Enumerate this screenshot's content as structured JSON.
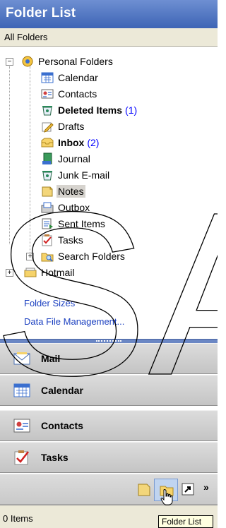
{
  "header": {
    "title": "Folder List"
  },
  "subheader": {
    "label": "All Folders"
  },
  "tree": {
    "root": {
      "label": "Personal Folders",
      "expander": "−"
    },
    "items": [
      {
        "label": "Calendar",
        "count": "",
        "icon": "calendar-icon"
      },
      {
        "label": "Contacts",
        "count": "",
        "icon": "contacts-icon"
      },
      {
        "label": "Deleted Items",
        "count": "(1)",
        "icon": "deleted-items-icon",
        "bold": true
      },
      {
        "label": "Drafts",
        "count": "",
        "icon": "drafts-icon"
      },
      {
        "label": "Inbox",
        "count": "(2)",
        "icon": "inbox-icon",
        "bold": true
      },
      {
        "label": "Journal",
        "count": "",
        "icon": "journal-icon"
      },
      {
        "label": "Junk E-mail",
        "count": "",
        "icon": "junk-icon"
      },
      {
        "label": "Notes",
        "count": "",
        "icon": "notes-icon",
        "selected": true
      },
      {
        "label": "Outbox",
        "count": "",
        "icon": "outbox-icon"
      },
      {
        "label": "Sent Items",
        "count": "",
        "icon": "sent-items-icon"
      },
      {
        "label": "Tasks",
        "count": "",
        "icon": "tasks-icon"
      },
      {
        "label": "Search Folders",
        "count": "",
        "icon": "search-folders-icon",
        "expander": "+"
      }
    ],
    "hotmail": {
      "label": "Hotmail",
      "expander": "+"
    }
  },
  "links": {
    "folder_sizes": "Folder Sizes",
    "data_file_management": "Data File Management..."
  },
  "nav": {
    "mail": "Mail",
    "calendar": "Calendar",
    "contacts": "Contacts",
    "tasks": "Tasks"
  },
  "bottombar": {
    "more": "»"
  },
  "status": {
    "items": "0 Items"
  },
  "tooltip": {
    "text": "Folder List"
  },
  "watermark": {
    "text": "SA"
  },
  "colors": {
    "header_top": "#6e8fd2",
    "header_bottom": "#3d64b5",
    "link": "#1a3fc0",
    "count": "#0000ff",
    "watermark": "#000000"
  }
}
